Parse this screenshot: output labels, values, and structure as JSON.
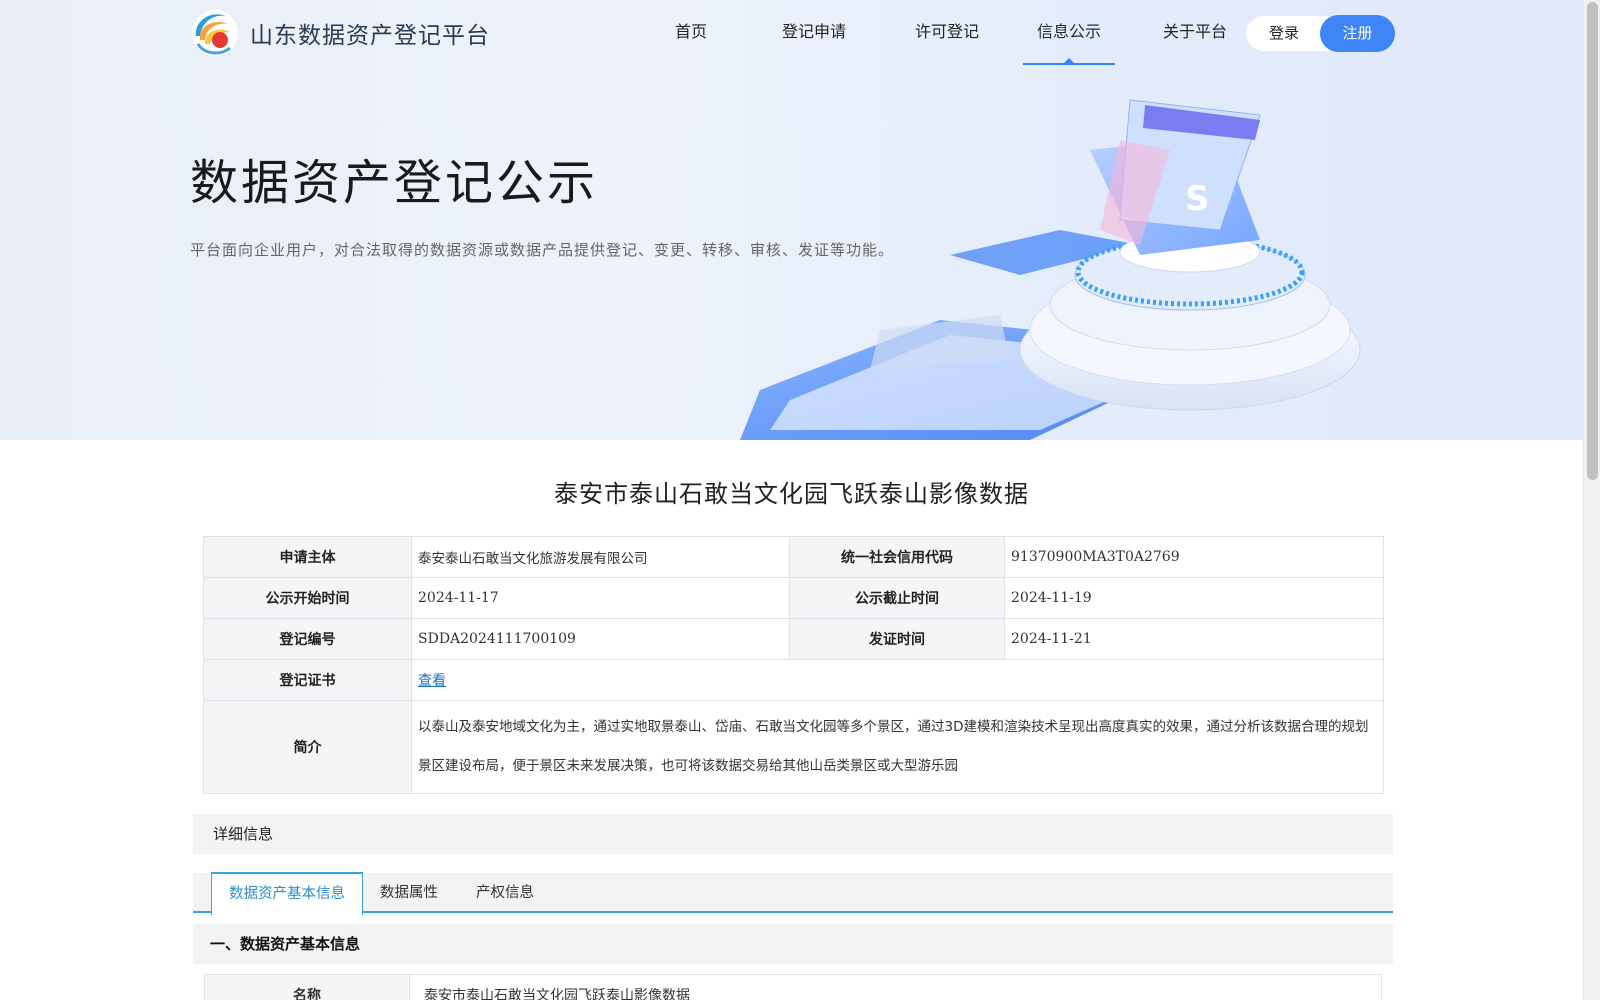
{
  "nav": {
    "logo_text": "山东数据资产登记平台",
    "items": [
      {
        "label": "首页",
        "active": false
      },
      {
        "label": "登记申请",
        "active": false
      },
      {
        "label": "许可登记",
        "active": false
      },
      {
        "label": "信息公示",
        "active": true
      },
      {
        "label": "关于平台",
        "active": false
      }
    ],
    "login_label": "登录",
    "register_label": "注册"
  },
  "hero": {
    "title": "数据资产登记公示",
    "description": "平台面向企业用户，对合法取得的数据资源或数据产品提供登记、变更、转移、审核、发证等功能。"
  },
  "record": {
    "title": "泰安市泰山石敢当文化园飞跃泰山影像数据",
    "rows": {
      "applicant_label": "申请主体",
      "applicant_value": "泰安泰山石敢当文化旅游发展有限公司",
      "credit_code_label": "统一社会信用代码",
      "credit_code_value": "91370900MA3T0A2769",
      "start_label": "公示开始时间",
      "start_value": "2024-11-17",
      "end_label": "公示截止时间",
      "end_value": "2024-11-19",
      "reg_no_label": "登记编号",
      "reg_no_value": "SDDA2024111700109",
      "issue_label": "发证时间",
      "issue_value": "2024-11-21",
      "cert_label": "登记证书",
      "cert_link": "查看",
      "intro_label": "简介",
      "intro_value": "以泰山及泰安地域文化为主，通过实地取景泰山、岱庙、石敢当文化园等多个景区，通过3D建模和渲染技术呈现出高度真实的效果，通过分析该数据合理的规划景区建设布局，便于景区未来发展决策，也可将该数据交易给其他山岳类景区或大型游乐园"
    }
  },
  "detail": {
    "header": "详细信息",
    "tabs": [
      {
        "label": "数据资产基本信息",
        "active": true
      },
      {
        "label": "数据属性",
        "active": false
      },
      {
        "label": "产权信息",
        "active": false
      }
    ],
    "section_title": "一、数据资产基本信息",
    "basic_rows": [
      {
        "label": "名称",
        "value": "泰安市泰山石敢当文化园飞跃泰山影像数据"
      }
    ]
  },
  "colors": {
    "accent": "#3e86f5",
    "tab_accent": "#3aa3de",
    "link": "#1a73c7"
  }
}
